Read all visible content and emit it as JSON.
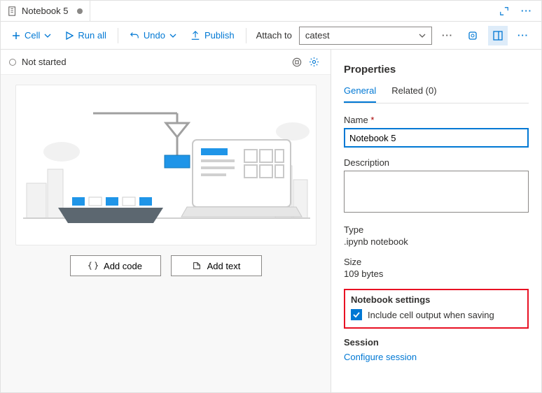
{
  "tab": {
    "title": "Notebook 5"
  },
  "toolbar": {
    "cell": "Cell",
    "run_all": "Run all",
    "undo": "Undo",
    "publish": "Publish",
    "attach_label": "Attach to",
    "attach_value": "catest"
  },
  "status": {
    "text": "Not started"
  },
  "empty_buttons": {
    "add_code": "Add code",
    "add_text": "Add text"
  },
  "properties": {
    "title": "Properties",
    "tabs": {
      "general": "General",
      "related": "Related (0)"
    },
    "name_label": "Name",
    "name_value": "Notebook 5",
    "desc_label": "Description",
    "desc_value": "",
    "type_label": "Type",
    "type_value": ".ipynb notebook",
    "size_label": "Size",
    "size_value": "109 bytes",
    "settings_head": "Notebook settings",
    "settings_checkbox": "Include cell output when saving",
    "session_head": "Session",
    "session_link": "Configure session"
  }
}
